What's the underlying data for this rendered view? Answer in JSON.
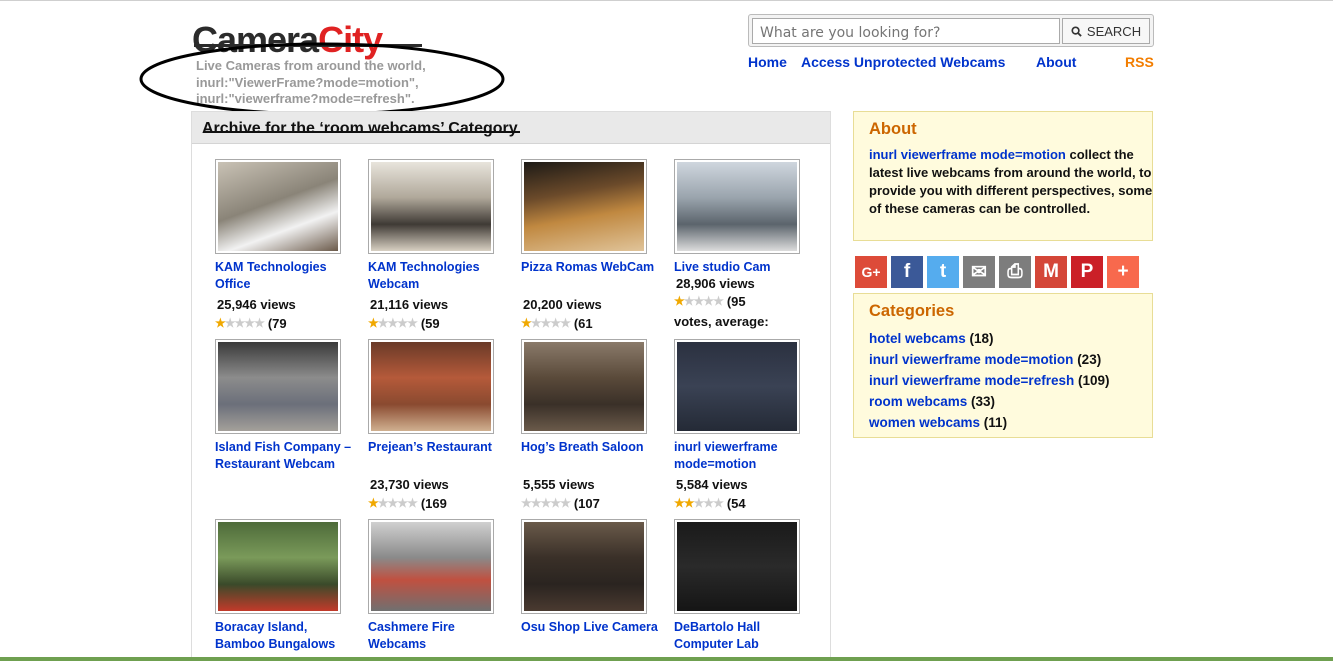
{
  "logo": {
    "part1": "Camera",
    "part2": "City"
  },
  "tagline": "Live Cameras from around the world, inurl:\"ViewerFrame?mode=motion\", inurl:\"viewerframe?mode=refresh\".",
  "search": {
    "placeholder": "What are you looking for?",
    "button_label": "SEARCH",
    "icon": "search-icon"
  },
  "nav": {
    "home": "Home",
    "access": "Access Unprotected Webcams",
    "about": "About",
    "rss": "RSS"
  },
  "archive": {
    "title": "Archive for the ‘room webcams’ Category",
    "cams": [
      {
        "name": "KAM Technologies Office",
        "views": "25,946 views",
        "stars": 1,
        "votes": "(79"
      },
      {
        "name": "KAM Technologies Webcam",
        "views": "21,116 views",
        "stars": 0.5,
        "votes": "(59"
      },
      {
        "name": "Pizza Romas WebCam",
        "views": "20,200 views",
        "stars": 1,
        "votes": "(61"
      },
      {
        "name": "Live studio Cam",
        "views": "28,906 views",
        "stars": 1,
        "votes": "(95",
        "votes_tail": "votes, average:"
      },
      {
        "name": "Island Fish Company – Restaurant Webcam",
        "views": "",
        "stars": null,
        "votes": ""
      },
      {
        "name": "Prejean’s Restaurant",
        "views": "23,730 views",
        "stars": 0.5,
        "votes": "(169"
      },
      {
        "name": "Hog’s Breath Saloon",
        "views": "5,555 views",
        "stars": 0,
        "votes": "(107"
      },
      {
        "name": "inurl viewerframe mode=motion",
        "views": "5,584 views",
        "stars": 2,
        "votes": "(54"
      },
      {
        "name": "Boracay Island, Bamboo Bungalows",
        "views": "",
        "stars": null,
        "votes": ""
      },
      {
        "name": "Cashmere Fire Webcams",
        "views": "",
        "stars": null,
        "votes": ""
      },
      {
        "name": "Osu Shop Live Camera",
        "views": "",
        "stars": null,
        "votes": ""
      },
      {
        "name": "DeBartolo Hall Computer Lab",
        "views": "",
        "stars": null,
        "votes": ""
      }
    ]
  },
  "about_box": {
    "title": "About",
    "link_text": "inurl viewerframe mode=motion",
    "text": " collect the latest live webcams from around the world, to provide you with different perspectives, some of these cameras can be controlled."
  },
  "share_buttons": [
    {
      "label": "G+",
      "icon": "google-plus-icon",
      "color": "#dd4b39"
    },
    {
      "label": "f",
      "icon": "facebook-icon",
      "color": "#3b5998"
    },
    {
      "label": "t",
      "icon": "twitter-icon",
      "color": "#55acee"
    },
    {
      "label": "✉",
      "icon": "email-icon",
      "color": "#7d7d7d"
    },
    {
      "label": "⎙",
      "icon": "print-icon",
      "color": "#7d7d7d"
    },
    {
      "label": "M",
      "icon": "gmail-icon",
      "color": "#d44638"
    },
    {
      "label": "P",
      "icon": "pinterest-icon",
      "color": "#cb2027"
    },
    {
      "label": "+",
      "icon": "more-share-icon",
      "color": "#f8694d"
    }
  ],
  "categories": {
    "title": "Categories",
    "items": [
      {
        "label": "hotel webcams",
        "count": "(18)"
      },
      {
        "label": "inurl viewerframe mode=motion",
        "count": "(23)"
      },
      {
        "label": "inurl viewerframe mode=refresh",
        "count": "(109)"
      },
      {
        "label": "room webcams",
        "count": "(33)"
      },
      {
        "label": "women webcams",
        "count": "(11)"
      }
    ]
  },
  "colors": {
    "link": "#0033cc",
    "accent_orange": "#cc6600",
    "logo_red": "#e02222",
    "box_bg": "#fffbdd"
  }
}
